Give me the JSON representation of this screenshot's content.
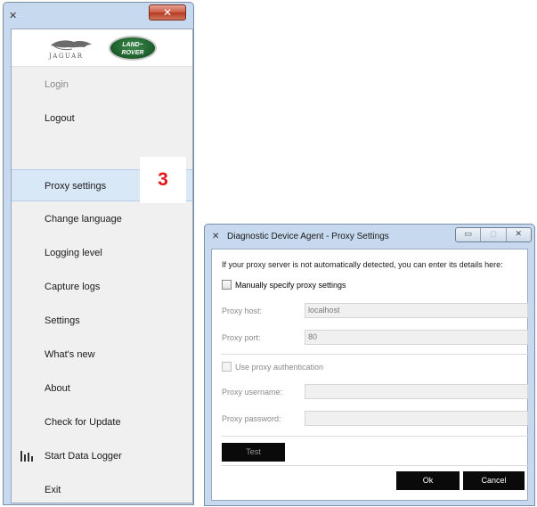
{
  "menu_window": {
    "app_icon_glyph": "✕",
    "close_glyph": "✕",
    "logo": {
      "jaguar_text": "JAGUAR",
      "land_rover_line1": "LAND~",
      "land_rover_line2": "ROVER"
    },
    "items": [
      {
        "id": "login",
        "label": "Login",
        "disabled": true
      },
      {
        "id": "logout",
        "label": "Logout",
        "disabled": false
      },
      {
        "id": "proxy",
        "label": "Proxy settings",
        "active": true
      },
      {
        "id": "language",
        "label": "Change language"
      },
      {
        "id": "logging",
        "label": "Logging level"
      },
      {
        "id": "capture",
        "label": "Capture logs"
      },
      {
        "id": "settings",
        "label": "Settings"
      },
      {
        "id": "whatsnew",
        "label": "What's new"
      },
      {
        "id": "about",
        "label": "About"
      },
      {
        "id": "update",
        "label": "Check for Update"
      },
      {
        "id": "datalogger",
        "label": "Start Data Logger",
        "icon": "bar-chart-icon"
      },
      {
        "id": "exit",
        "label": "Exit"
      }
    ],
    "callout_number": "3",
    "callout_color": "#e8131b"
  },
  "proxy_dialog": {
    "title": "Diagnostic Device Agent - Proxy Settings",
    "app_icon_glyph": "✕",
    "window_buttons": {
      "minimize": "▭",
      "maximize": "◻",
      "close": "✕"
    },
    "intro_text": "If your proxy server is not automatically detected, you can enter its details here:",
    "manual_checkbox_label": "Manually specify proxy settings",
    "proxy_host_label": "Proxy host:",
    "proxy_host_value": "localhost",
    "proxy_port_label": "Proxy port:",
    "proxy_port_value": "80",
    "auth_checkbox_label": "Use proxy authentication",
    "username_label": "Proxy username:",
    "username_value": "",
    "password_label": "Proxy password:",
    "password_value": "",
    "test_label": "Test",
    "ok_label": "Ok",
    "cancel_label": "Cancel"
  }
}
